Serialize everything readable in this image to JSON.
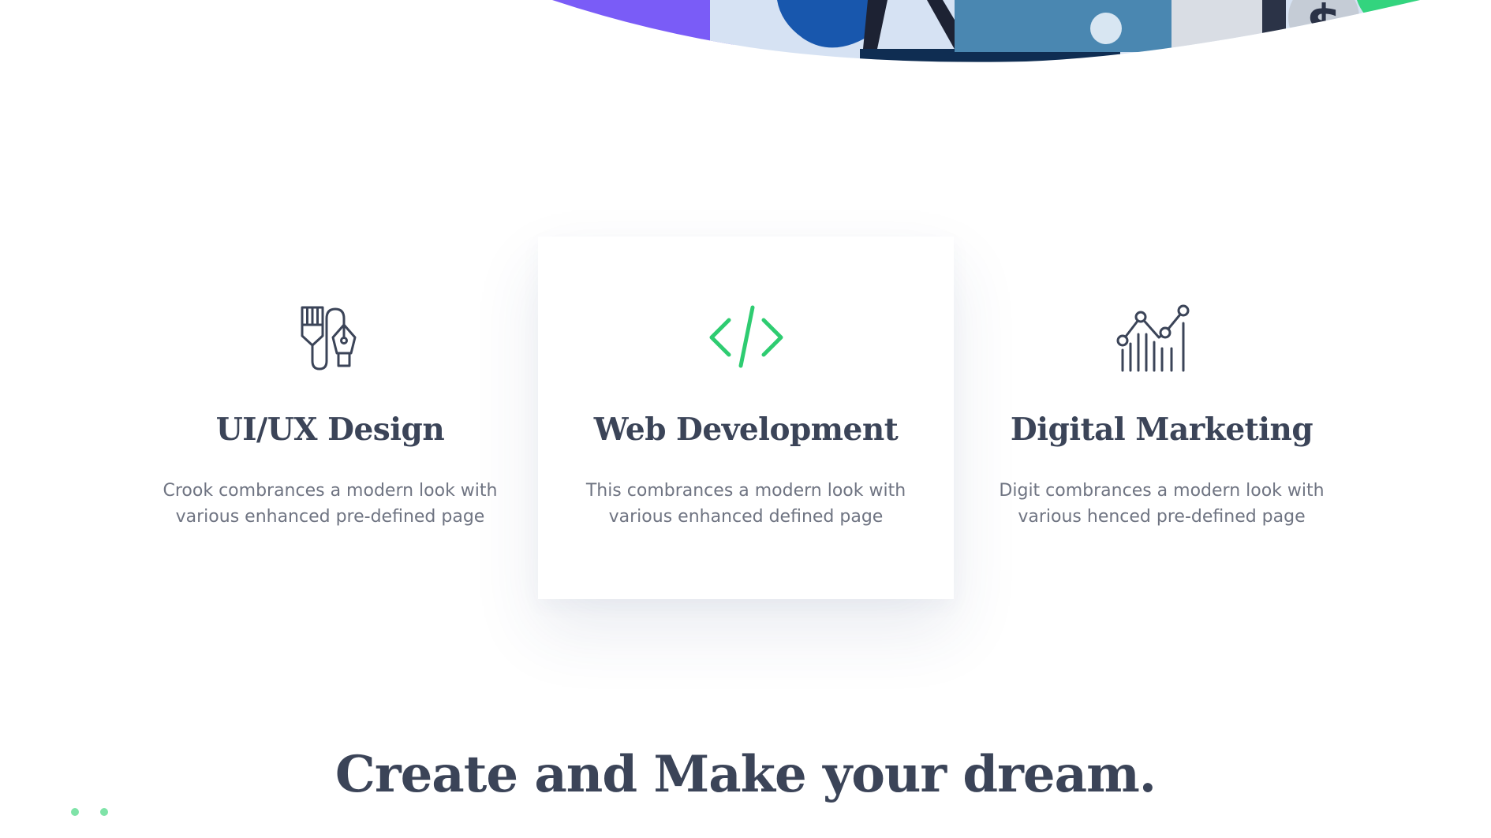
{
  "hero": {
    "currency_symbol": "$"
  },
  "services": [
    {
      "title": "UI/UX Design",
      "description": "Crook combrances a modern look with\nvarious enhanced pre-defined page",
      "icon": "pen-tools-icon",
      "icon_color": "#3b4458"
    },
    {
      "title": "Web Development",
      "description": "This combrances a modern look with\nvarious enhanced defined page",
      "icon": "code-brackets-icon",
      "icon_color": "#2ecc71"
    },
    {
      "title": "Digital Marketing",
      "description": "Digit combrances a modern look with\nvarious henced pre-defined page",
      "icon": "line-bar-chart-icon",
      "icon_color": "#3b4458"
    }
  ],
  "headline": "Create and Make your dream.",
  "colors": {
    "text_dark": "#3b4458",
    "text_muted": "#6f7482",
    "accent_green": "#2ecc71",
    "dot_green": "#7fe3a8",
    "hero_purple": "#6b4cf5",
    "hero_blue": "#1a5fb4",
    "hero_navy": "#0f2a4a"
  }
}
